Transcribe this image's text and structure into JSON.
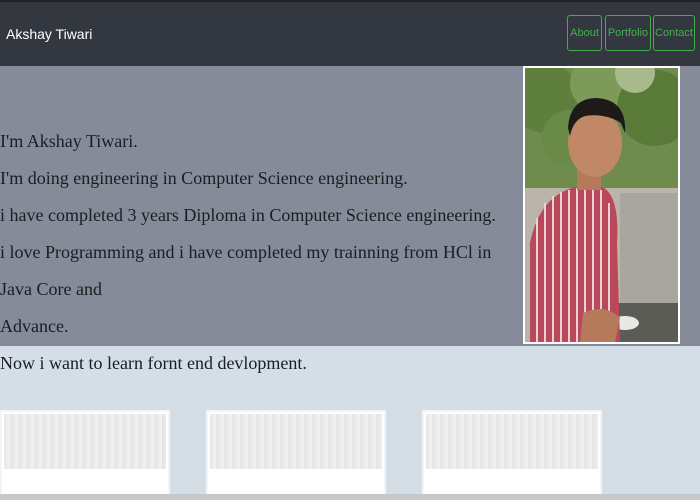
{
  "navbar": {
    "brand": "Akshay Tiwari",
    "links": [
      "About",
      "Portfolio",
      "Contact"
    ]
  },
  "hero": {
    "bio_lines": [
      "I'm Akshay Tiwari.",
      "I'm doing engineering in Computer Science engineering.",
      "i have completed 3 years Diploma in Computer Science engineering.",
      "i love Programming and i have completed my trainning from HCl in Java Core and",
      "Advance.",
      "Now i want to learn fornt end devlopment."
    ]
  },
  "colors": {
    "navbar_bg": "#33373f",
    "nav_accent": "#43b14f",
    "hero_bg": "#868b99",
    "page_bg": "#d3dee6"
  }
}
